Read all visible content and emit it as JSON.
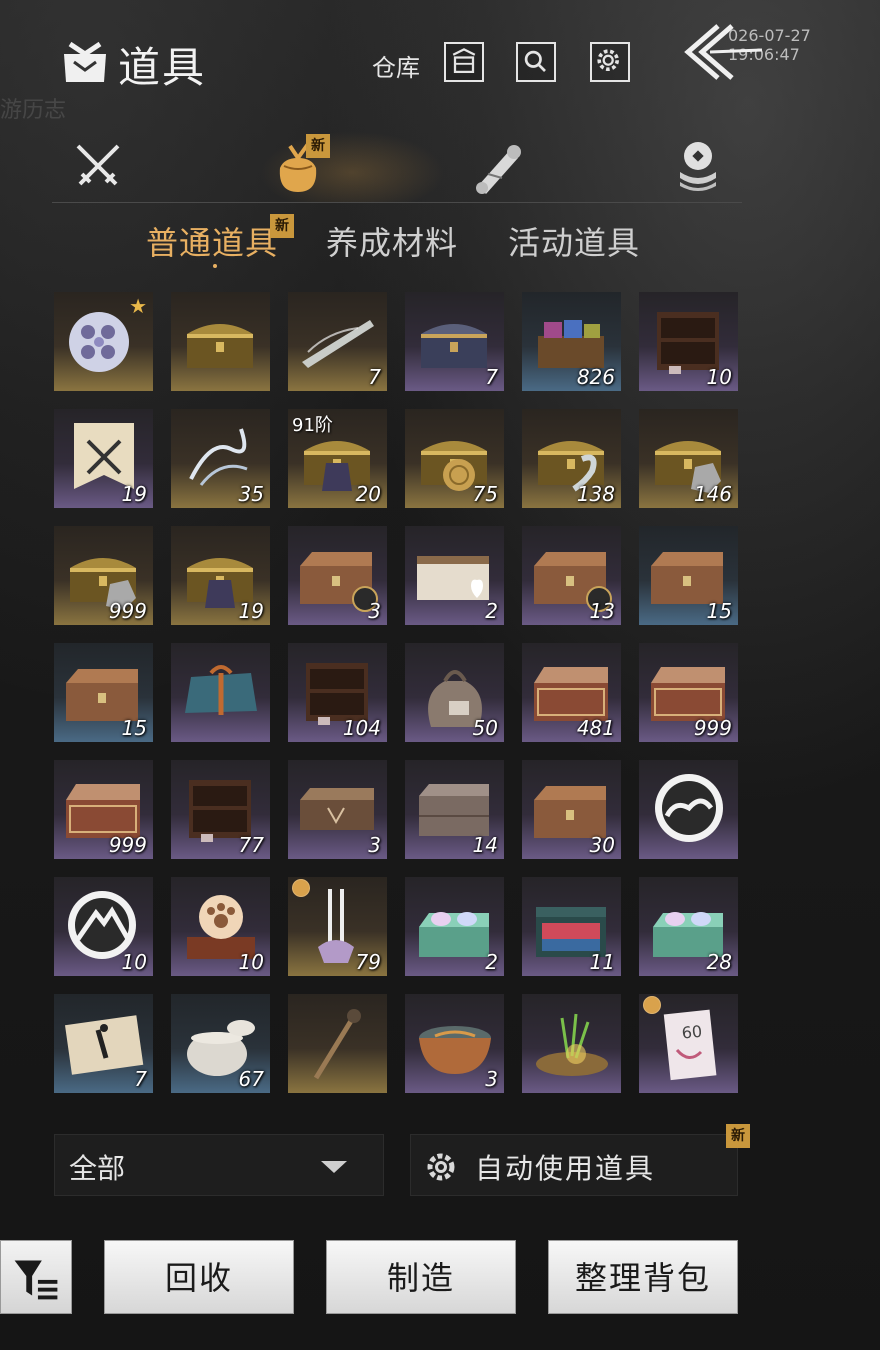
{
  "header": {
    "title": "道具",
    "warehouse_label": "仓库",
    "timestamp": "026-07-27 19:06:47",
    "ghost_tabs": [
      "游历志"
    ]
  },
  "categories": [
    {
      "name": "weapon",
      "icon": "crossed-swords-icon",
      "active": false
    },
    {
      "name": "items",
      "icon": "pouch-icon",
      "active": true,
      "badge": "新"
    },
    {
      "name": "scroll",
      "icon": "scroll-icon",
      "active": false
    },
    {
      "name": "token",
      "icon": "coin-icon",
      "active": false
    }
  ],
  "subtabs": [
    {
      "label": "普通道具",
      "active": true,
      "badge": "新"
    },
    {
      "label": "养成材料",
      "active": false
    },
    {
      "label": "活动道具",
      "active": false
    }
  ],
  "items": [
    {
      "icon": "silver-orb",
      "rarity": "gold",
      "count": "",
      "star": true
    },
    {
      "icon": "gold-chest",
      "rarity": "gold",
      "count": ""
    },
    {
      "icon": "jade-sword",
      "rarity": "gold",
      "count": "7"
    },
    {
      "icon": "ornate-chest-blue",
      "rarity": "purple",
      "count": "7"
    },
    {
      "icon": "fabric-chest",
      "rarity": "blue",
      "count": "826"
    },
    {
      "icon": "wood-cabinet",
      "rarity": "purple",
      "count": "10"
    },
    {
      "icon": "sword-banner",
      "rarity": "purple",
      "count": "19"
    },
    {
      "icon": "spirit-wisp",
      "rarity": "gold",
      "count": "35"
    },
    {
      "icon": "robe-chest",
      "rarity": "gold",
      "count": "20",
      "tier": "91阶"
    },
    {
      "icon": "shell-chest",
      "rarity": "gold",
      "count": "75"
    },
    {
      "icon": "flower-chest",
      "rarity": "gold",
      "count": "138"
    },
    {
      "icon": "ore-chest",
      "rarity": "gold",
      "count": "146"
    },
    {
      "icon": "ore-chest",
      "rarity": "gold",
      "count": "999"
    },
    {
      "icon": "robe-chest",
      "rarity": "gold",
      "count": "19"
    },
    {
      "icon": "wood-box",
      "rarity": "purple",
      "count": "3",
      "mini_badge": true
    },
    {
      "icon": "heart-box",
      "rarity": "purple",
      "count": "2"
    },
    {
      "icon": "wood-box",
      "rarity": "purple",
      "count": "13",
      "mini_badge": true
    },
    {
      "icon": "wood-box",
      "rarity": "blue",
      "count": "15"
    },
    {
      "icon": "wood-box",
      "rarity": "blue",
      "count": "15"
    },
    {
      "icon": "gift-bundle",
      "rarity": "purple",
      "count": ""
    },
    {
      "icon": "wood-cabinet",
      "rarity": "purple",
      "count": "104"
    },
    {
      "icon": "cloth-sack",
      "rarity": "purple",
      "count": "50"
    },
    {
      "icon": "carved-chest",
      "rarity": "purple",
      "count": "481"
    },
    {
      "icon": "carved-chest",
      "rarity": "purple",
      "count": "999"
    },
    {
      "icon": "carved-chest",
      "rarity": "purple",
      "count": "999"
    },
    {
      "icon": "wood-cabinet",
      "rarity": "purple",
      "count": "77"
    },
    {
      "icon": "etched-box",
      "rarity": "purple",
      "count": "3"
    },
    {
      "icon": "stone-box",
      "rarity": "purple",
      "count": "14"
    },
    {
      "icon": "wood-box",
      "rarity": "purple",
      "count": "30"
    },
    {
      "icon": "cloud-emblem",
      "rarity": "purple",
      "count": ""
    },
    {
      "icon": "mountain-emblem",
      "rarity": "purple",
      "count": "10"
    },
    {
      "icon": "paw-orb",
      "rarity": "purple",
      "count": "10"
    },
    {
      "icon": "incense-stand",
      "rarity": "gold",
      "count": "79",
      "clock": true
    },
    {
      "icon": "gem-tray",
      "rarity": "purple",
      "count": "2"
    },
    {
      "icon": "scroll-case",
      "rarity": "purple",
      "count": "11"
    },
    {
      "icon": "gem-tray",
      "rarity": "purple",
      "count": "28"
    },
    {
      "icon": "ink-scroll",
      "rarity": "blue",
      "count": "7"
    },
    {
      "icon": "porcelain-jar",
      "rarity": "blue",
      "count": "67"
    },
    {
      "icon": "wood-staff",
      "rarity": "gold",
      "count": ""
    },
    {
      "icon": "soup-bowl",
      "rarity": "purple",
      "count": "3"
    },
    {
      "icon": "herb-pile",
      "rarity": "purple",
      "count": ""
    },
    {
      "icon": "coupon-card",
      "rarity": "purple",
      "count": "",
      "clock": true,
      "card_text": "60"
    }
  ],
  "bottom": {
    "filter_value": "全部",
    "auto_use_label": "自动使用道具",
    "auto_use_badge": "新",
    "recycle_label": "回收",
    "craft_label": "制造",
    "sort_label": "整理背包"
  }
}
